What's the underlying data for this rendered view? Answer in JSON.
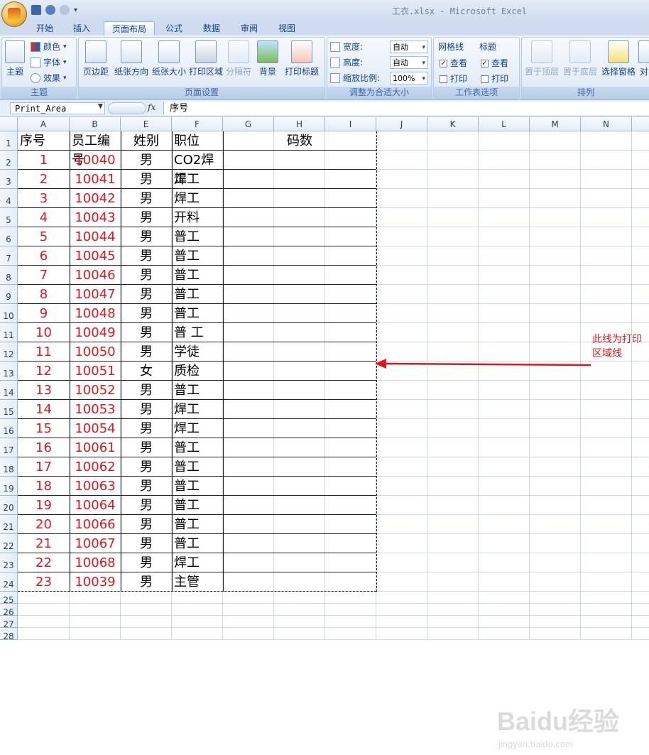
{
  "window": {
    "title": "工衣.xlsx - Microsoft Excel"
  },
  "tabs": [
    "开始",
    "插入",
    "页面布局",
    "公式",
    "数据",
    "审阅",
    "视图"
  ],
  "ribbon": {
    "theme_group": {
      "big": "主题",
      "items": [
        "颜色",
        "字体",
        "效果"
      ],
      "label": "主题"
    },
    "page_setup": {
      "buttons": [
        "页边距",
        "纸张方向",
        "纸张大小",
        "打印区域",
        "分隔符",
        "背景",
        "打印标题"
      ],
      "label": "页面设置"
    },
    "scale": {
      "width_label": "宽度:",
      "width_value": "自动",
      "height_label": "高度:",
      "height_value": "自动",
      "zoom_label": "缩放比例:",
      "zoom_value": "100%",
      "label": "调整为合适大小"
    },
    "sheet_options": {
      "gridlines": "网格线",
      "headings": "标题",
      "view": "查看",
      "print": "打印",
      "label": "工作表选项"
    },
    "arrange": {
      "buttons": [
        "置于顶层",
        "置于底层",
        "选择窗格",
        "对"
      ],
      "label": "排列"
    }
  },
  "formula_bar": {
    "name_box": "Print_Area",
    "fx": "fx",
    "content": "序号"
  },
  "columns": [
    "A",
    "B",
    "E",
    "F",
    "G",
    "H",
    "I",
    "J",
    "K",
    "L",
    "M",
    "N"
  ],
  "header_row": {
    "a": "序号",
    "b": "员工编号",
    "e": "姓别",
    "f": "职位",
    "gi": "码数"
  },
  "rows": [
    {
      "a": "1",
      "b": "10040",
      "e": "男",
      "f": "CO2焊工"
    },
    {
      "a": "2",
      "b": "10041",
      "e": "男",
      "f": "焊工"
    },
    {
      "a": "3",
      "b": "10042",
      "e": "男",
      "f": "焊工"
    },
    {
      "a": "4",
      "b": "10043",
      "e": "男",
      "f": "开料"
    },
    {
      "a": "5",
      "b": "10044",
      "e": "男",
      "f": "普工"
    },
    {
      "a": "6",
      "b": "10045",
      "e": "男",
      "f": "普工"
    },
    {
      "a": "7",
      "b": "10046",
      "e": "男",
      "f": "普工"
    },
    {
      "a": "8",
      "b": "10047",
      "e": "男",
      "f": "普工"
    },
    {
      "a": "9",
      "b": "10048",
      "e": "男",
      "f": "普工"
    },
    {
      "a": "10",
      "b": "10049",
      "e": "男",
      "f": "普 工"
    },
    {
      "a": "11",
      "b": "10050",
      "e": "男",
      "f": "学徒"
    },
    {
      "a": "12",
      "b": "10051",
      "e": "女",
      "f": "质检"
    },
    {
      "a": "13",
      "b": "10052",
      "e": "男",
      "f": "普工"
    },
    {
      "a": "14",
      "b": "10053",
      "e": "男",
      "f": "焊工"
    },
    {
      "a": "15",
      "b": "10054",
      "e": "男",
      "f": "焊工"
    },
    {
      "a": "16",
      "b": "10061",
      "e": "男",
      "f": "普工"
    },
    {
      "a": "17",
      "b": "10062",
      "e": "男",
      "f": "普工"
    },
    {
      "a": "18",
      "b": "10063",
      "e": "男",
      "f": "普工"
    },
    {
      "a": "19",
      "b": "10064",
      "e": "男",
      "f": "普工"
    },
    {
      "a": "20",
      "b": "10066",
      "e": "男",
      "f": "普工"
    },
    {
      "a": "21",
      "b": "10067",
      "e": "男",
      "f": "普工"
    },
    {
      "a": "22",
      "b": "10068",
      "e": "男",
      "f": "焊工"
    },
    {
      "a": "23",
      "b": "10039",
      "e": "男",
      "f": "主管"
    }
  ],
  "row_numbers": [
    "1",
    "2",
    "3",
    "4",
    "5",
    "6",
    "7",
    "8",
    "9",
    "10",
    "11",
    "12",
    "13",
    "14",
    "15",
    "16",
    "17",
    "18",
    "19",
    "20",
    "21",
    "22",
    "23",
    "24",
    "25",
    "26",
    "27",
    "28"
  ],
  "annotation": "此线为打印区域线",
  "watermark": {
    "brand": "Baidu经验",
    "url": "jingyan.baidu.com"
  },
  "colors": {
    "accent_red": "#e0161b"
  }
}
